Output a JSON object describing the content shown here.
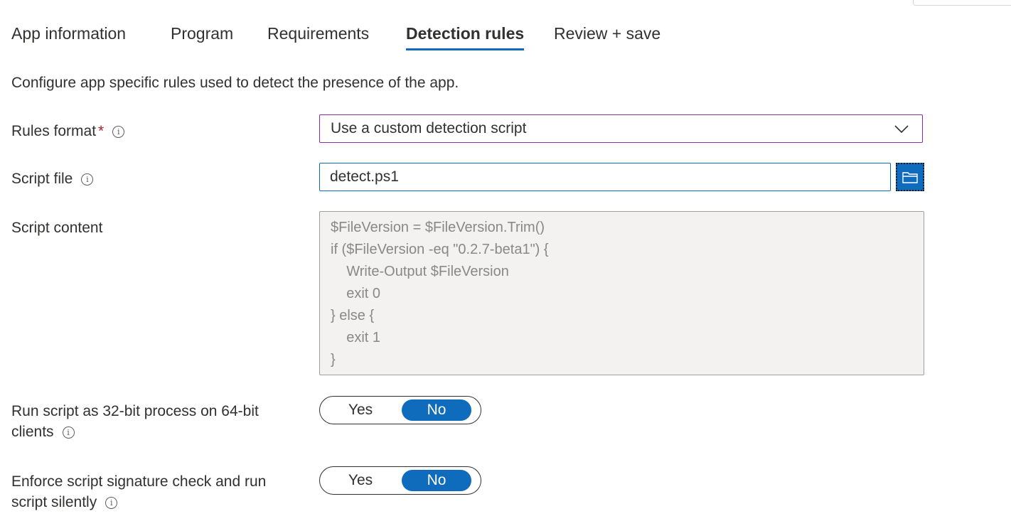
{
  "tabs": [
    {
      "label": "App information",
      "active": false
    },
    {
      "label": "Program",
      "active": false
    },
    {
      "label": "Requirements",
      "active": false
    },
    {
      "label": "Detection rules",
      "active": true
    },
    {
      "label": "Review + save",
      "active": false
    }
  ],
  "description": "Configure app specific rules used to detect the presence of the app.",
  "rules_format": {
    "label": "Rules format",
    "required_mark": "*",
    "info": "i",
    "value": "Use a custom detection script"
  },
  "script_file": {
    "label": "Script file",
    "info": "i",
    "value": "detect.ps1"
  },
  "script_content": {
    "label": "Script content",
    "lines": [
      "$FileVersion = $FileVersion.Trim()",
      "if ($FileVersion -eq \"0.2.7-beta1\") {",
      "    Write-Output $FileVersion",
      "    exit 0",
      "} else {",
      "    exit 1",
      "}"
    ]
  },
  "run_32bit": {
    "label_line1": "Run script as 32-bit process on 64-bit",
    "label_line2": "clients",
    "info": "i",
    "yes": "Yes",
    "no": "No",
    "selected": "No"
  },
  "enforce_signature": {
    "label_line1": "Enforce script signature check and run",
    "label_line2": "script silently",
    "info": "i",
    "yes": "Yes",
    "no": "No",
    "selected": "No"
  },
  "colors": {
    "accent": "#0f6cbd",
    "dropdown_border": "#8a2da5",
    "required": "#a4262c"
  },
  "icons": {
    "dropdown": "chevron-down-icon",
    "browse": "folder-icon",
    "info": "info-icon"
  }
}
